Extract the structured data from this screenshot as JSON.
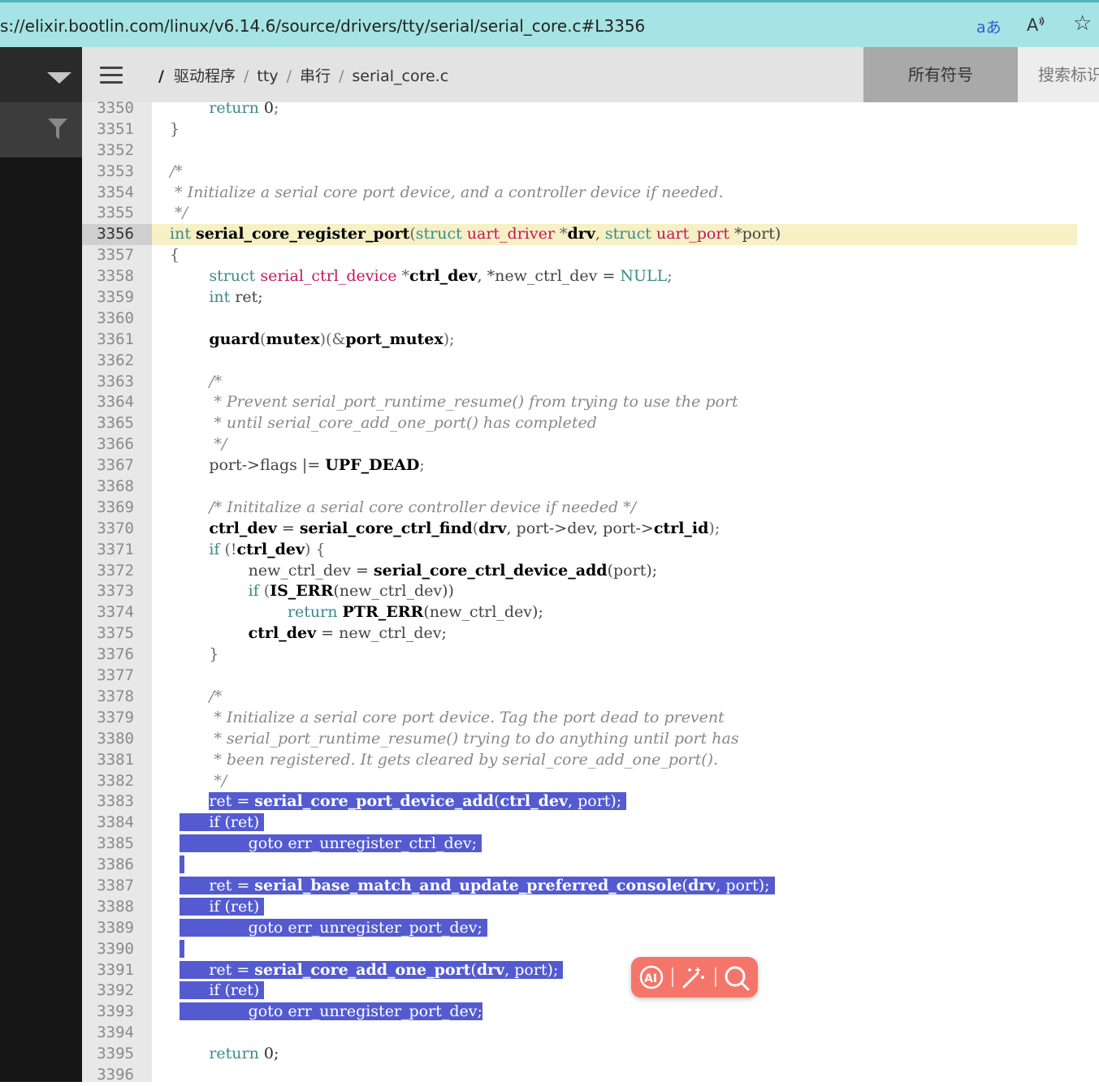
{
  "browser": {
    "url": "s://elixir.bootlin.com/linux/v6.14.6/source/drivers/tty/serial/serial_core.c#L3356",
    "translate_icon_text": "aあ",
    "read_aloud_icon_text": "A⁾",
    "favorite_icon_text": "☆"
  },
  "header": {
    "root": "/",
    "crumbs": [
      "驱动程序",
      "tty",
      "串行",
      "serial_core.c"
    ],
    "separator": "/",
    "all_symbols_label": "所有符号",
    "search_label": "搜索标识"
  },
  "code": {
    "highlighted_line": 3356,
    "lines": [
      {
        "n": "3350",
        "t": [
          [
            "        ",
            "pl"
          ],
          [
            "return",
            "kw"
          ],
          [
            " 0",
            "nm"
          ],
          [
            ";",
            "pu"
          ]
        ]
      },
      {
        "n": "3351",
        "t": [
          [
            "}",
            "pu"
          ]
        ]
      },
      {
        "n": "3352",
        "t": []
      },
      {
        "n": "3353",
        "t": [
          [
            "/*",
            "cm"
          ]
        ]
      },
      {
        "n": "3354",
        "t": [
          [
            " * Initialize a serial core port device, and a controller device if needed.",
            "cm"
          ]
        ]
      },
      {
        "n": "3355",
        "t": [
          [
            " */",
            "cm"
          ]
        ]
      },
      {
        "n": "3356",
        "t": [
          [
            "int",
            "kw"
          ],
          [
            " ",
            "pl"
          ],
          [
            "serial_core_register_port",
            "id"
          ],
          [
            "(",
            "pu"
          ],
          [
            "struct",
            "kw"
          ],
          [
            " ",
            "pl"
          ],
          [
            "uart_driver",
            "ty"
          ],
          [
            " *",
            "pu"
          ],
          [
            "drv",
            "id"
          ],
          [
            ", ",
            "pu"
          ],
          [
            "struct",
            "kw"
          ],
          [
            " ",
            "pl"
          ],
          [
            "uart_port",
            "ty"
          ],
          [
            " *port)",
            "pl"
          ]
        ]
      },
      {
        "n": "3357",
        "t": [
          [
            "{",
            "pu"
          ]
        ]
      },
      {
        "n": "3358",
        "t": [
          [
            "        ",
            "pl"
          ],
          [
            "struct",
            "kw"
          ],
          [
            " ",
            "pl"
          ],
          [
            "serial_ctrl_device",
            "ty"
          ],
          [
            " *",
            "pu"
          ],
          [
            "ctrl_dev",
            "id"
          ],
          [
            ", *new_ctrl_dev = ",
            "pl"
          ],
          [
            "NULL",
            "kw"
          ],
          [
            ";",
            "pu"
          ]
        ]
      },
      {
        "n": "3359",
        "t": [
          [
            "        ",
            "pl"
          ],
          [
            "int",
            "kw"
          ],
          [
            " ret;",
            "pl"
          ]
        ]
      },
      {
        "n": "3360",
        "t": []
      },
      {
        "n": "3361",
        "t": [
          [
            "        ",
            "pl"
          ],
          [
            "guard",
            "id"
          ],
          [
            "(",
            "pu"
          ],
          [
            "mutex",
            "id"
          ],
          [
            ")(&",
            "pu"
          ],
          [
            "port_mutex",
            "id"
          ],
          [
            ");",
            "pu"
          ]
        ]
      },
      {
        "n": "3362",
        "t": []
      },
      {
        "n": "3363",
        "t": [
          [
            "        /*",
            "cm"
          ]
        ]
      },
      {
        "n": "3364",
        "t": [
          [
            "         * Prevent serial_port_runtime_resume() from trying to use the port",
            "cm"
          ]
        ]
      },
      {
        "n": "3365",
        "t": [
          [
            "         * until serial_core_add_one_port() has completed",
            "cm"
          ]
        ]
      },
      {
        "n": "3366",
        "t": [
          [
            "         */",
            "cm"
          ]
        ]
      },
      {
        "n": "3367",
        "t": [
          [
            "        port->flags |= ",
            "pl"
          ],
          [
            "UPF_DEAD",
            "id"
          ],
          [
            ";",
            "pu"
          ]
        ]
      },
      {
        "n": "3368",
        "t": []
      },
      {
        "n": "3369",
        "t": [
          [
            "        /* Inititalize a serial core controller device if needed */",
            "cm"
          ]
        ]
      },
      {
        "n": "3370",
        "t": [
          [
            "        ",
            "pl"
          ],
          [
            "ctrl_dev",
            "id"
          ],
          [
            " = ",
            "pl"
          ],
          [
            "serial_core_ctrl_find",
            "id"
          ],
          [
            "(",
            "pu"
          ],
          [
            "drv",
            "id"
          ],
          [
            ", port->dev, port->",
            "pl"
          ],
          [
            "ctrl_id",
            "id"
          ],
          [
            ");",
            "pu"
          ]
        ]
      },
      {
        "n": "3371",
        "t": [
          [
            "        ",
            "pl"
          ],
          [
            "if",
            "kw"
          ],
          [
            " (!",
            "pu"
          ],
          [
            "ctrl_dev",
            "id"
          ],
          [
            ") {",
            "pu"
          ]
        ]
      },
      {
        "n": "3372",
        "t": [
          [
            "                new_ctrl_dev = ",
            "pl"
          ],
          [
            "serial_core_ctrl_device_add",
            "id"
          ],
          [
            "(port);",
            "pl"
          ]
        ]
      },
      {
        "n": "3373",
        "t": [
          [
            "                ",
            "pl"
          ],
          [
            "if",
            "kw"
          ],
          [
            " (",
            "pu"
          ],
          [
            "IS_ERR",
            "id"
          ],
          [
            "(new_ctrl_dev))",
            "pl"
          ]
        ]
      },
      {
        "n": "3374",
        "t": [
          [
            "                        ",
            "pl"
          ],
          [
            "return",
            "kw"
          ],
          [
            " ",
            "pl"
          ],
          [
            "PTR_ERR",
            "id"
          ],
          [
            "(new_ctrl_dev);",
            "pl"
          ]
        ]
      },
      {
        "n": "3375",
        "t": [
          [
            "                ",
            "pl"
          ],
          [
            "ctrl_dev",
            "id"
          ],
          [
            " = new_ctrl_dev;",
            "pl"
          ]
        ]
      },
      {
        "n": "3376",
        "t": [
          [
            "        }",
            "pu"
          ]
        ]
      },
      {
        "n": "3377",
        "t": []
      },
      {
        "n": "3378",
        "t": [
          [
            "        /*",
            "cm"
          ]
        ]
      },
      {
        "n": "3379",
        "t": [
          [
            "         * Initialize a serial core port device. Tag the port dead to prevent",
            "cm"
          ]
        ]
      },
      {
        "n": "3380",
        "t": [
          [
            "         * serial_port_runtime_resume() trying to do anything until port has",
            "cm"
          ]
        ]
      },
      {
        "n": "3381",
        "t": [
          [
            "         * been registered. It gets cleared by serial_core_add_one_port().",
            "cm"
          ]
        ]
      },
      {
        "n": "3382",
        "t": [
          [
            "         */",
            "cm"
          ]
        ]
      },
      {
        "n": "3383",
        "t": [
          [
            "        ",
            "pl"
          ],
          [
            "ret = ",
            "pl",
            "s"
          ],
          [
            "serial_core_port_device_add",
            "id",
            "s"
          ],
          [
            "(",
            "pu",
            "s"
          ],
          [
            "ctrl_dev",
            "id",
            "s"
          ],
          [
            ", port); ",
            "pl",
            "s"
          ]
        ]
      },
      {
        "n": "3384",
        "t": [
          [
            "  ",
            "pl"
          ],
          [
            "      if (ret) ",
            "pl",
            "s"
          ]
        ]
      },
      {
        "n": "3385",
        "t": [
          [
            "  ",
            "pl"
          ],
          [
            "              goto err_unregister_ctrl_dev; ",
            "pl",
            "s"
          ]
        ]
      },
      {
        "n": "3386",
        "t": [
          [
            "  ",
            "pl"
          ],
          [
            " ",
            "pl",
            "s"
          ]
        ]
      },
      {
        "n": "3387",
        "t": [
          [
            "  ",
            "pl"
          ],
          [
            "      ret = ",
            "pl",
            "s"
          ],
          [
            "serial_base_match_and_update_preferred_console",
            "id",
            "s"
          ],
          [
            "(",
            "pu",
            "s"
          ],
          [
            "drv",
            "id",
            "s"
          ],
          [
            ", port); ",
            "pl",
            "s"
          ]
        ]
      },
      {
        "n": "3388",
        "t": [
          [
            "  ",
            "pl"
          ],
          [
            "      if (ret) ",
            "pl",
            "s"
          ]
        ]
      },
      {
        "n": "3389",
        "t": [
          [
            "  ",
            "pl"
          ],
          [
            "              goto err_unregister_port_dev; ",
            "pl",
            "s"
          ]
        ]
      },
      {
        "n": "3390",
        "t": [
          [
            "  ",
            "pl"
          ],
          [
            " ",
            "pl",
            "s"
          ]
        ]
      },
      {
        "n": "3391",
        "t": [
          [
            "  ",
            "pl"
          ],
          [
            "      ret = ",
            "pl",
            "s"
          ],
          [
            "serial_core_add_one_port",
            "id",
            "s"
          ],
          [
            "(",
            "pu",
            "s"
          ],
          [
            "drv",
            "id",
            "s"
          ],
          [
            ", port); ",
            "pl",
            "s"
          ]
        ]
      },
      {
        "n": "3392",
        "t": [
          [
            "  ",
            "pl"
          ],
          [
            "      if (ret) ",
            "pl",
            "s"
          ]
        ]
      },
      {
        "n": "3393",
        "t": [
          [
            "  ",
            "pl"
          ],
          [
            "              goto err_unregister_port_dev;",
            "pl",
            "s"
          ]
        ]
      },
      {
        "n": "3394",
        "t": []
      },
      {
        "n": "3395",
        "t": [
          [
            "        ",
            "pl"
          ],
          [
            "return",
            "kw"
          ],
          [
            " 0;",
            "nm"
          ]
        ]
      },
      {
        "n": "3396",
        "t": []
      }
    ]
  },
  "colors": {
    "selection": "#545bd0",
    "highlight_line": "#f6f0c4",
    "keyword": "#3c8a8a",
    "type": "#c2185b",
    "toolbar": "#f4766a"
  },
  "floating_toolbar": {
    "icons": [
      "ai-icon",
      "magic-wand-icon",
      "search-icon"
    ]
  }
}
